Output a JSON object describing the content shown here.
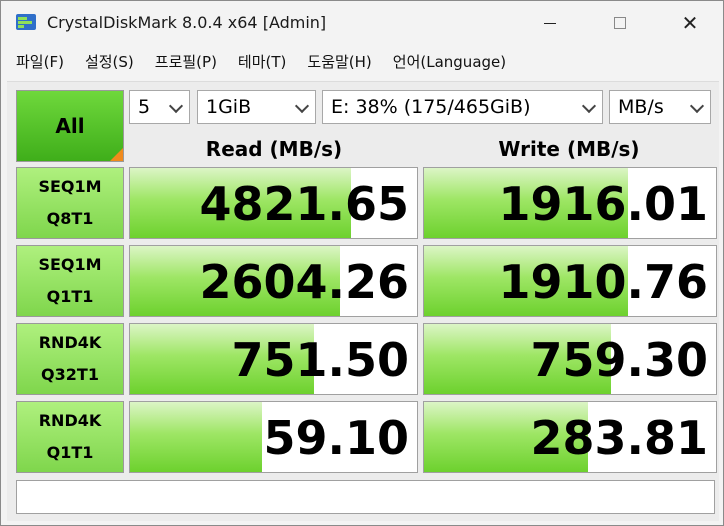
{
  "window": {
    "title": "CrystalDiskMark 8.0.4 x64 [Admin]",
    "icon": "crystaldiskmark-icon"
  },
  "menu": [
    "파일(F)",
    "설정(S)",
    "프로필(P)",
    "테마(T)",
    "도움말(H)",
    "언어(Language)"
  ],
  "controls": {
    "all_label": "All",
    "count": "5",
    "size": "1GiB",
    "drive": "E: 38% (175/465GiB)",
    "unit": "MB/s"
  },
  "headers": {
    "read": "Read (MB/s)",
    "write": "Write (MB/s)"
  },
  "tests": [
    {
      "line1": "SEQ1M",
      "line2": "Q8T1",
      "read": "4821.65",
      "write": "1916.01",
      "read_fill": 0.77,
      "write_fill": 0.7
    },
    {
      "line1": "SEQ1M",
      "line2": "Q1T1",
      "read": "2604.26",
      "write": "1910.76",
      "read_fill": 0.73,
      "write_fill": 0.7
    },
    {
      "line1": "RND4K",
      "line2": "Q32T1",
      "read": "751.50",
      "write": "759.30",
      "read_fill": 0.64,
      "write_fill": 0.64
    },
    {
      "line1": "RND4K",
      "line2": "Q1T1",
      "read": "59.10",
      "write": "283.81",
      "read_fill": 0.46,
      "write_fill": 0.56
    }
  ],
  "comment": "",
  "colors": {
    "bar_green": "#6dd12e",
    "all_button": "#4fc021",
    "corner_orange": "#f08a1c"
  }
}
